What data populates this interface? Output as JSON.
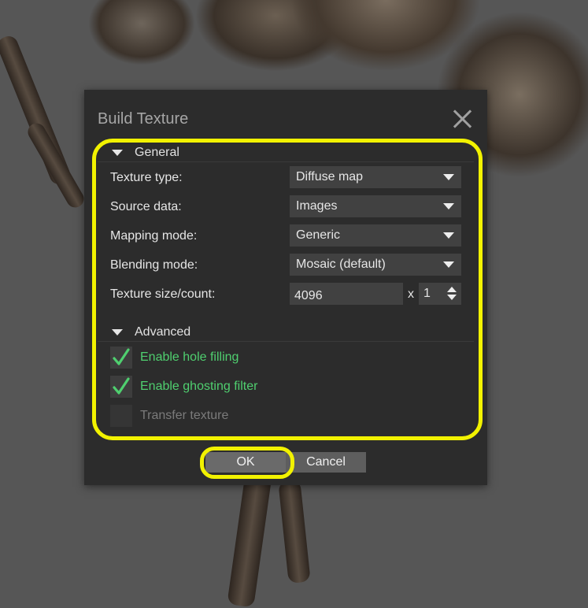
{
  "dialog": {
    "title": "Build Texture",
    "close_icon": "close-icon"
  },
  "general": {
    "header": "General",
    "rows": [
      {
        "label": "Texture type:",
        "value": "Diffuse map"
      },
      {
        "label": "Source data:",
        "value": "Images"
      },
      {
        "label": "Mapping mode:",
        "value": "Generic"
      },
      {
        "label": "Blending mode:",
        "value": "Mosaic (default)"
      }
    ],
    "texture_size": {
      "label": "Texture size/count:",
      "size": "4096",
      "separator": "x",
      "count": "1"
    }
  },
  "advanced": {
    "header": "Advanced",
    "options": [
      {
        "label": "Enable hole filling",
        "checked": true,
        "enabled": true
      },
      {
        "label": "Enable ghosting filter",
        "checked": true,
        "enabled": true
      },
      {
        "label": "Transfer texture",
        "checked": false,
        "enabled": false
      }
    ]
  },
  "buttons": {
    "ok": "OK",
    "cancel": "Cancel"
  },
  "colors": {
    "highlight": "#f2f200",
    "check_green": "#4fcf6f",
    "dialog_bg": "#2c2c2c",
    "field_bg": "#414141"
  }
}
